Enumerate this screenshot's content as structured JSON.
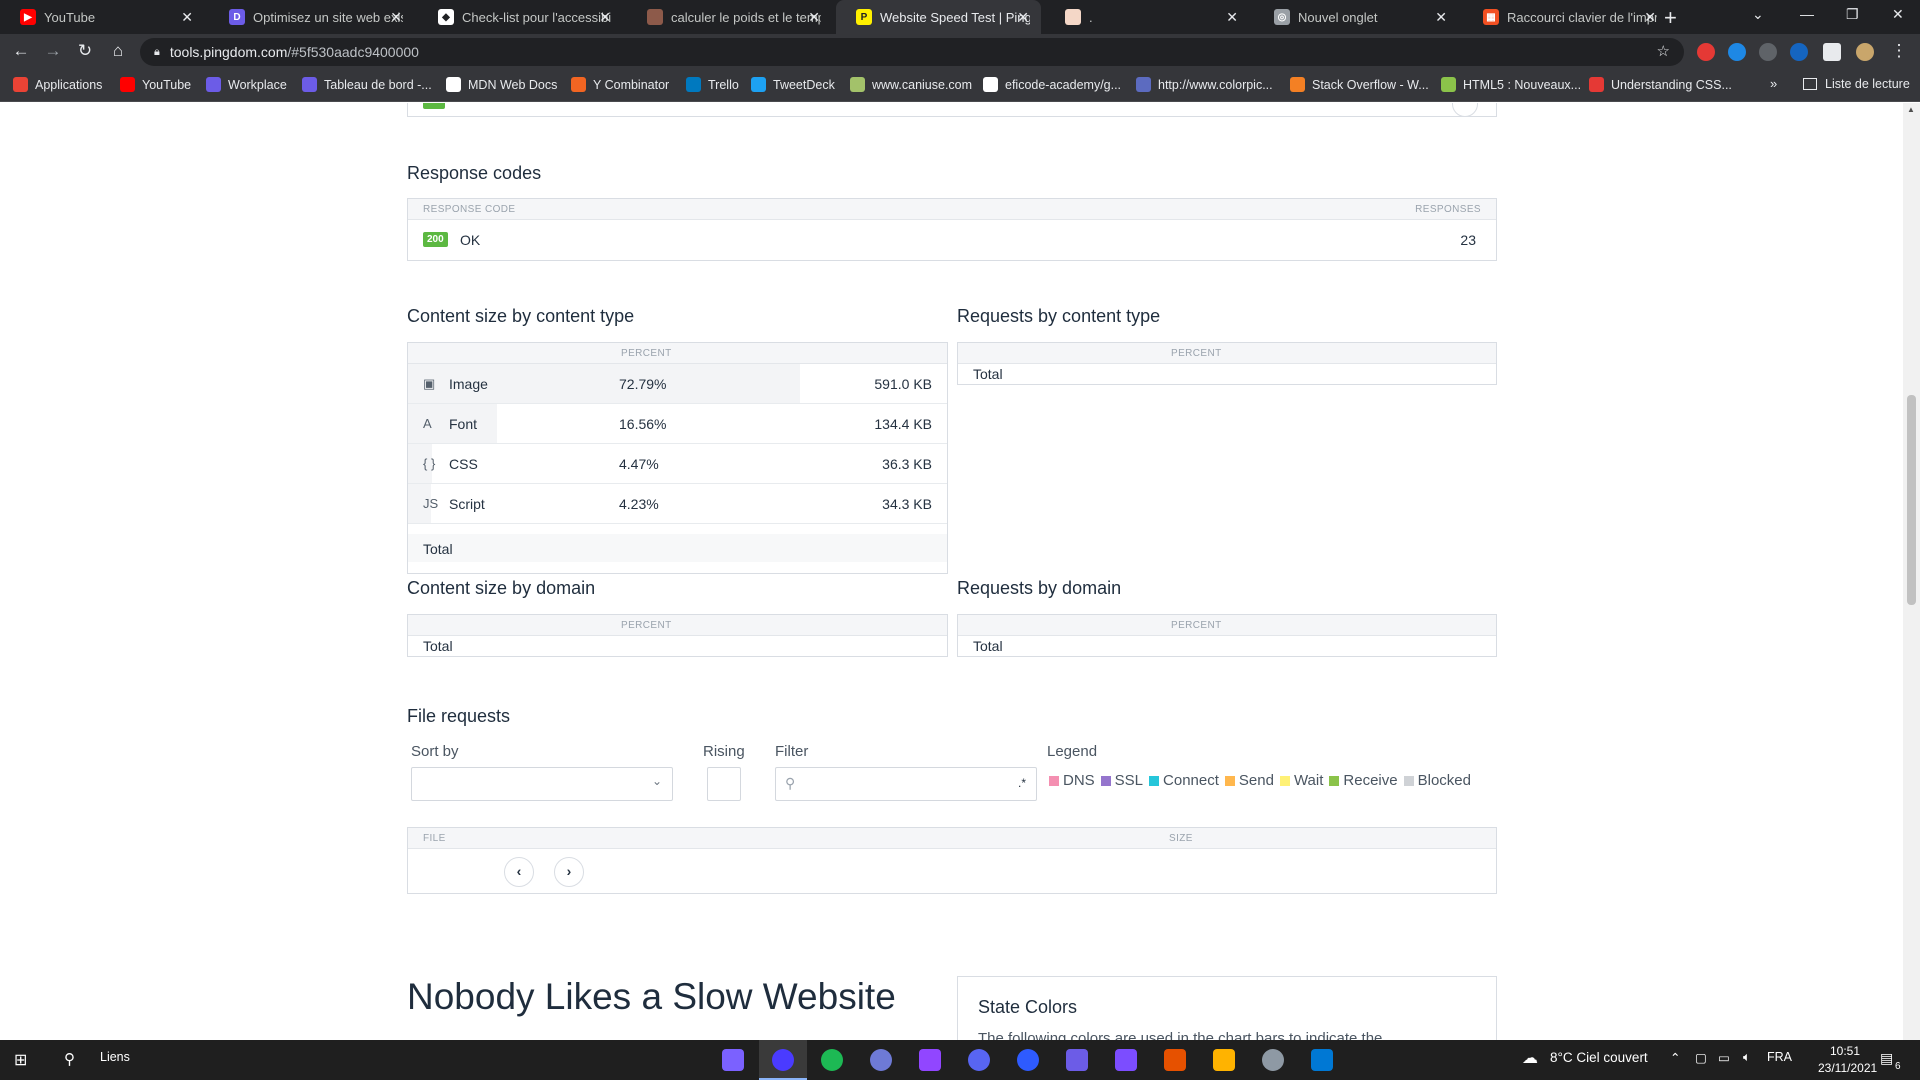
{
  "browser": {
    "tabs": [
      {
        "label": "YouTube",
        "icon": "youtube-icon",
        "color": "#ff0000",
        "glyph": "▶"
      },
      {
        "label": "Optimisez un site web exis",
        "icon": "openclassrooms-icon",
        "color": "#6c5ce7",
        "glyph": "D"
      },
      {
        "label": "Check-list pour l'accessibil",
        "icon": "checklist-icon",
        "color": "#ffffff",
        "glyph": "◆"
      },
      {
        "label": "calculer le poids et le temp",
        "icon": "avatar-icon",
        "color": "#8d5a4a",
        "glyph": ""
      },
      {
        "label": "Website Speed Test | Pingd",
        "icon": "pingdom-icon",
        "color": "#fff000",
        "glyph": "P"
      },
      {
        "label": ".",
        "icon": "page-icon",
        "color": "#f4d7c7",
        "glyph": ""
      },
      {
        "label": "Nouvel onglet",
        "icon": "chrome-icon",
        "color": "#9aa0a6",
        "glyph": "◎"
      },
      {
        "label": "Raccourci clavier de l'impr",
        "icon": "microsoft-icon",
        "color": "#f25022",
        "glyph": "▦"
      }
    ],
    "url_host": "tools.pingdom.com",
    "url_path": "/#5f530aadc9400000",
    "bookmarks": [
      {
        "label": "Applications",
        "color": "#ea4335"
      },
      {
        "label": "YouTube",
        "color": "#ff0000"
      },
      {
        "label": "Workplace",
        "color": "#6c5ce7"
      },
      {
        "label": "Tableau de bord -...",
        "color": "#6c5ce7"
      },
      {
        "label": "MDN Web Docs",
        "color": "#ffffff"
      },
      {
        "label": "Y Combinator",
        "color": "#f26522"
      },
      {
        "label": "Trello",
        "color": "#0079bf"
      },
      {
        "label": "TweetDeck",
        "color": "#1da1f2"
      },
      {
        "label": "www.caniuse.com",
        "color": "#a3c26a"
      },
      {
        "label": "eficode-academy/g...",
        "color": "#ffffff"
      },
      {
        "label": "http://www.colorpic...",
        "color": "#5c6bc0"
      },
      {
        "label": "Stack Overflow - W...",
        "color": "#f48024"
      },
      {
        "label": "HTML5 : Nouveaux...",
        "color": "#8bc34a"
      },
      {
        "label": "Understanding CSS...",
        "color": "#e53935"
      }
    ],
    "more": "»",
    "reading_list": "Liste de lecture"
  },
  "response_codes": {
    "title": "Response codes",
    "col_code": "RESPONSE CODE",
    "col_responses": "RESPONSES",
    "rows": [
      {
        "code": "200",
        "text": "OK",
        "count": "23"
      }
    ]
  },
  "content_size_type": {
    "title": "Content size by content type",
    "col_percent": "PERCENT",
    "rows": [
      {
        "icon": "image-icon",
        "glyph": "▣",
        "label": "Image",
        "percent": "72.79%",
        "size": "591.0 KB",
        "share": 0.7279
      },
      {
        "icon": "font-icon",
        "glyph": "A",
        "label": "Font",
        "percent": "16.56%",
        "size": "134.4 KB",
        "share": 0.1656
      },
      {
        "icon": "css-icon",
        "glyph": "{ }",
        "label": "CSS",
        "percent": "4.47%",
        "size": "36.3 KB",
        "share": 0.0447
      },
      {
        "icon": "script-icon",
        "glyph": "JS",
        "label": "Script",
        "percent": "4.23%",
        "size": "34.3 KB",
        "share": 0.0423
      }
    ],
    "total": "Total"
  },
  "requests_type": {
    "title": "Requests by content type",
    "col_percent": "PERCENT",
    "total": "Total"
  },
  "content_size_domain": {
    "title": "Content size by domain",
    "col_percent": "PERCENT",
    "total": "Total"
  },
  "requests_domain": {
    "title": "Requests by domain",
    "col_percent": "PERCENT",
    "total": "Total"
  },
  "file_requests": {
    "title": "File requests",
    "sort_by": "Sort by",
    "rising": "Rising",
    "filter": "Filter",
    "filter_regex": ".*",
    "legend_title": "Legend",
    "legend": [
      {
        "label": "DNS",
        "color": "#f48fb1"
      },
      {
        "label": "SSL",
        "color": "#9575cd"
      },
      {
        "label": "Connect",
        "color": "#26c6da"
      },
      {
        "label": "Send",
        "color": "#ffb74d"
      },
      {
        "label": "Wait",
        "color": "#fff176"
      },
      {
        "label": "Receive",
        "color": "#8bc34a"
      },
      {
        "label": "Blocked",
        "color": "#cfd2d6"
      }
    ],
    "col_file": "FILE",
    "col_size": "SIZE",
    "prev": "‹",
    "next": "›"
  },
  "promo": {
    "title": "Nobody Likes a Slow Website"
  },
  "state_colors": {
    "title": "State Colors",
    "text": "The following colors are used in the chart bars to indicate the"
  },
  "taskbar": {
    "search_label": "Liens",
    "weather": "8°C  Ciel couvert",
    "lang": "FRA",
    "time": "10:51",
    "date": "23/11/2021",
    "notif_count": "6"
  }
}
